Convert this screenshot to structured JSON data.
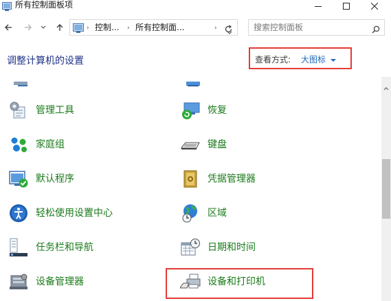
{
  "window": {
    "title": "所有控制面板项"
  },
  "nav": {
    "crumbs": [
      "控制...",
      "所有控制面..."
    ],
    "separator": "›"
  },
  "search": {
    "placeholder": "搜索控制面板"
  },
  "header": {
    "title": "调整计算机的设置",
    "view_by_label": "查看方式:",
    "view_by_value": "大图标"
  },
  "colors": {
    "link_green": "#1a7a1a",
    "header_blue": "#1e3287",
    "accent_blue": "#1f6bb8",
    "highlight_red": "#e53935"
  },
  "items": {
    "left": [
      {
        "label": "管理工具",
        "icon": "admin-tools-icon"
      },
      {
        "label": "家庭组",
        "icon": "homegroup-icon"
      },
      {
        "label": "默认程序",
        "icon": "default-programs-icon"
      },
      {
        "label": "轻松使用设置中心",
        "icon": "ease-of-access-icon"
      },
      {
        "label": "任务栏和导航",
        "icon": "taskbar-icon"
      },
      {
        "label": "设备管理器",
        "icon": "device-manager-icon"
      }
    ],
    "right": [
      {
        "label": "恢复",
        "icon": "recovery-icon"
      },
      {
        "label": "键盘",
        "icon": "keyboard-icon"
      },
      {
        "label": "凭据管理器",
        "icon": "credential-manager-icon"
      },
      {
        "label": "区域",
        "icon": "region-icon"
      },
      {
        "label": "日期和时间",
        "icon": "date-time-icon"
      },
      {
        "label": "设备和打印机",
        "icon": "devices-printers-icon"
      }
    ]
  }
}
